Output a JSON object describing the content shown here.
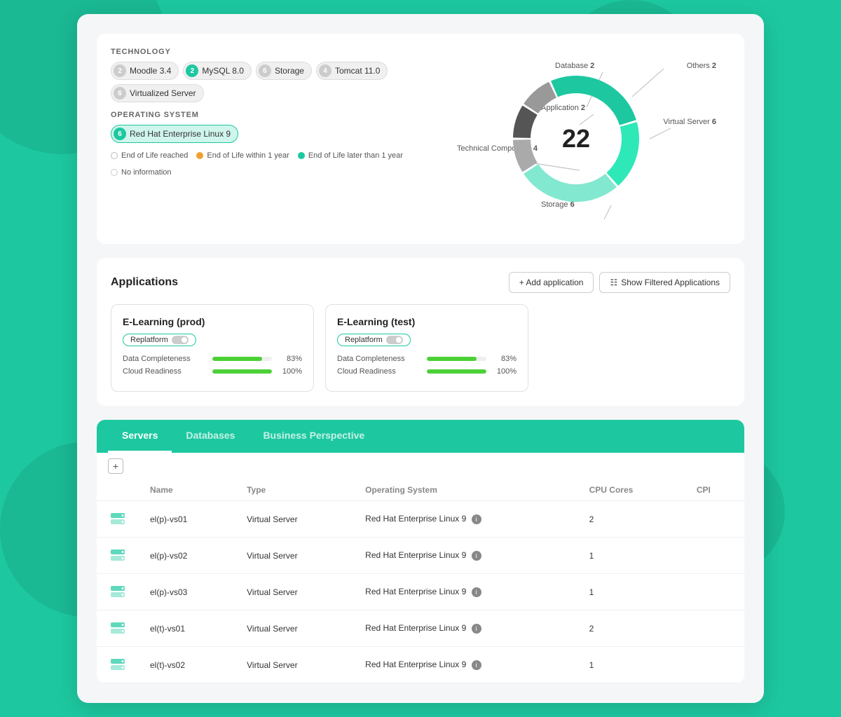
{
  "background_color": "#1dc8a0",
  "technology": {
    "label": "TECHNOLOGY",
    "tags": [
      {
        "badge": "2",
        "badge_color": "gray",
        "name": "Moodle 3.4"
      },
      {
        "badge": "2",
        "badge_color": "teal",
        "name": "MySQL 8.0"
      },
      {
        "badge": "6",
        "badge_color": "gray",
        "name": "Storage"
      },
      {
        "badge": "4",
        "badge_color": "gray",
        "name": "Tomcat 11.0"
      },
      {
        "badge": "6",
        "badge_color": "gray",
        "name": "Virtualized Server"
      }
    ]
  },
  "operating_system": {
    "label": "OPERATING SYSTEM",
    "tags": [
      {
        "badge": "6",
        "badge_color": "teal",
        "name": "Red Hat Enterprise Linux 9"
      }
    ]
  },
  "legend": [
    {
      "type": "gray-empty",
      "label": "End of Life reached"
    },
    {
      "type": "orange",
      "label": "End of Life within 1 year"
    },
    {
      "type": "teal",
      "label": "End of Life later than 1 year"
    },
    {
      "type": "light-gray",
      "label": "No information"
    }
  ],
  "donut": {
    "total": "22",
    "segments": [
      {
        "label": "Database",
        "value": 2,
        "color": "#555",
        "pct": 9
      },
      {
        "label": "Others",
        "value": 2,
        "color": "#999",
        "pct": 9
      },
      {
        "label": "Virtual Server",
        "value": 6,
        "color": "#1dc8a0",
        "pct": 27
      },
      {
        "label": "Technical Component",
        "value": 4,
        "color": "#2ee8b8",
        "pct": 18
      },
      {
        "label": "Storage",
        "value": 6,
        "color": "#83e8d0",
        "pct": 27
      },
      {
        "label": "Application",
        "value": 2,
        "color": "#aaa",
        "pct": 9
      }
    ]
  },
  "applications": {
    "title": "Applications",
    "add_button": "+ Add application",
    "filter_button": "Show Filtered Applications",
    "cards": [
      {
        "title": "E-Learning (prod)",
        "badge": "Replatform",
        "data_completeness": 83,
        "cloud_readiness": 100
      },
      {
        "title": "E-Learning (test)",
        "badge": "Replatform",
        "data_completeness": 83,
        "cloud_readiness": 100
      }
    ]
  },
  "tabs": [
    {
      "label": "Servers",
      "active": true
    },
    {
      "label": "Databases",
      "active": false
    },
    {
      "label": "Business Perspective",
      "active": false
    }
  ],
  "table": {
    "columns": [
      "Name",
      "Type",
      "Operating System",
      "CPU Cores",
      "CPI"
    ],
    "rows": [
      {
        "name": "el(p)-vs01",
        "type": "Virtual Server",
        "os": "Red Hat Enterprise Linux 9",
        "cpu": "2",
        "cpi": ""
      },
      {
        "name": "el(p)-vs02",
        "type": "Virtual Server",
        "os": "Red Hat Enterprise Linux 9",
        "cpu": "1",
        "cpi": ""
      },
      {
        "name": "el(p)-vs03",
        "type": "Virtual Server",
        "os": "Red Hat Enterprise Linux 9",
        "cpu": "1",
        "cpi": ""
      },
      {
        "name": "el(t)-vs01",
        "type": "Virtual Server",
        "os": "Red Hat Enterprise Linux 9",
        "cpu": "2",
        "cpi": ""
      },
      {
        "name": "el(t)-vs02",
        "type": "Virtual Server",
        "os": "Red Hat Enterprise Linux 9",
        "cpu": "1",
        "cpi": ""
      }
    ]
  }
}
